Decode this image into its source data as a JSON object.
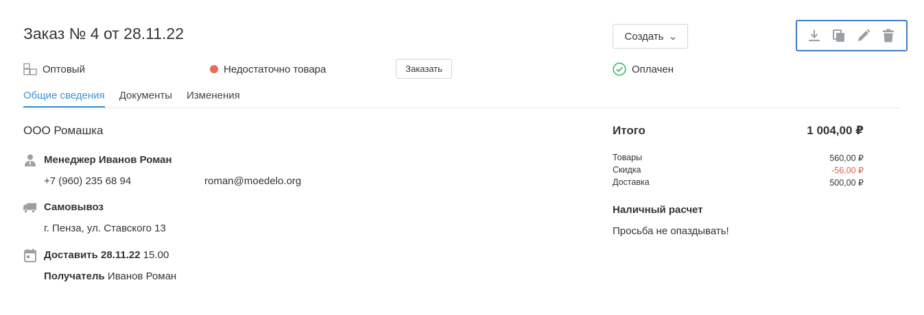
{
  "order": {
    "title": "Заказ № 4 от 28.11.22"
  },
  "actions": {
    "create_label": "Создать",
    "order_label": "Заказать",
    "toolbar_icons": [
      "download-icon",
      "copy-icon",
      "edit-icon",
      "delete-icon"
    ]
  },
  "statuses": {
    "type_label": "Оптовый",
    "stock_label": "Недостаточно товара",
    "payment_status_label": "Оплачен"
  },
  "tabs": [
    {
      "label": "Общие сведения",
      "active": true
    },
    {
      "label": "Документы",
      "active": false
    },
    {
      "label": "Изменения",
      "active": false
    }
  ],
  "client": {
    "company": "ООО Ромашка",
    "manager_label": "Менеджер Иванов Роман",
    "phone": "+7 (960) 235 68 94",
    "email": "roman@moedelo.org"
  },
  "delivery": {
    "method": "Самовывоз",
    "address": "г. Пенза, ул. Ставского 13",
    "date_label": "Доставить 28.11.22",
    "time": "15.00",
    "recipient_label": "Получатель",
    "recipient_name": "Иванов Роман"
  },
  "summary": {
    "total_label": "Итого",
    "total_value": "1 004,00 ₽",
    "rows": [
      {
        "label": "Товары",
        "value": "560,00 ₽"
      },
      {
        "label": "Скидка",
        "value": "-56,00 ₽"
      },
      {
        "label": "Доставка",
        "value": "500,00 ₽"
      }
    ],
    "payment_method": "Наличный расчет",
    "comment": "Просьба не опаздывать!"
  },
  "colors": {
    "accent": "#3d8fd8",
    "toolbar_border": "#3d7cc9",
    "status_red": "#ed6a5a",
    "status_green": "#3fb56b",
    "negative": "#e05b4b",
    "icon_gray": "#9aa0a6"
  }
}
